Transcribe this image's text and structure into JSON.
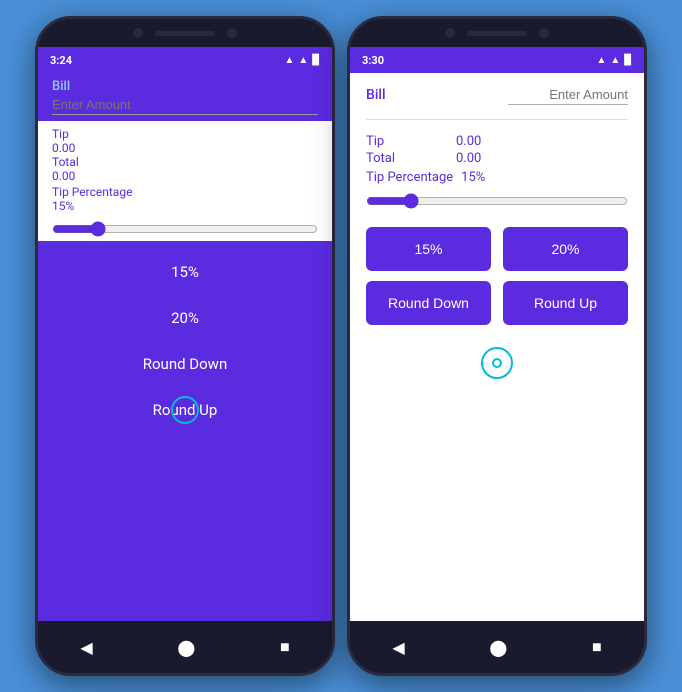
{
  "left_phone": {
    "status_time": "3:24",
    "status_icons": [
      "♥",
      "✦",
      "⊕",
      "▪",
      "▲",
      "▉"
    ],
    "bill_label": "Bill",
    "bill_placeholder": "Enter Amount",
    "tip_label": "Tip",
    "tip_value": "0.00",
    "total_label": "Total",
    "total_value": "0.00",
    "tip_pct_label": "Tip Percentage",
    "tip_pct_value": "15%",
    "slider_value": 15,
    "dropdown_items": [
      "15%",
      "20%",
      "Round Down",
      "Round Up"
    ],
    "nav_back": "◀",
    "nav_home": "⬤",
    "nav_recent": "■"
  },
  "right_phone": {
    "status_time": "3:30",
    "status_icons": [
      "✦",
      "⊕",
      "▪",
      "▲",
      "▉"
    ],
    "bill_label": "Bill",
    "bill_placeholder": "Enter Amount",
    "tip_label": "Tip",
    "tip_value": "0.00",
    "total_label": "Total",
    "total_value": "0.00",
    "tip_pct_label": "Tip Percentage",
    "tip_pct_value": "15%",
    "slider_value": 15,
    "btn_15": "15%",
    "btn_20": "20%",
    "btn_round_down": "Round Down",
    "btn_round_up": "Round Up",
    "nav_back": "◀",
    "nav_home": "⬤",
    "nav_recent": "■"
  }
}
